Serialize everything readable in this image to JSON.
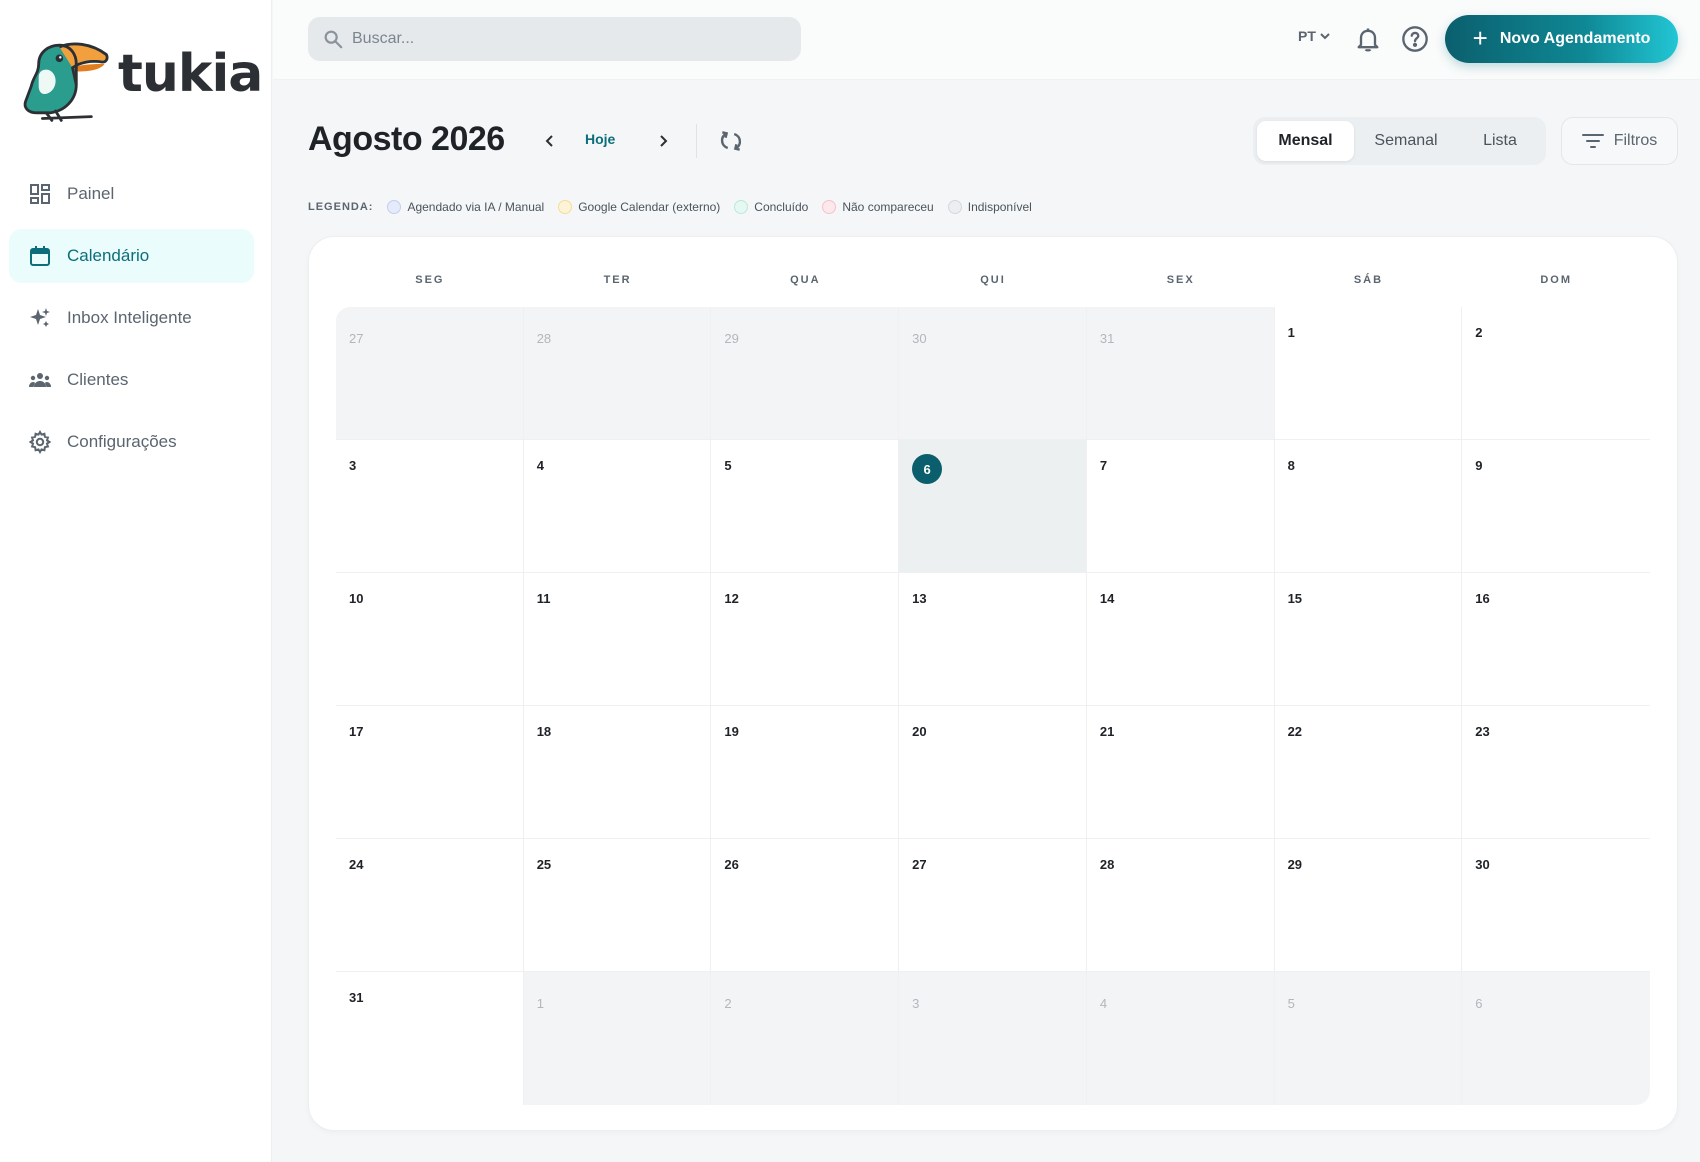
{
  "brand": {
    "name": "tukia"
  },
  "sidebar": {
    "items": [
      {
        "label": "Painel",
        "icon": "dashboard-icon",
        "active": false
      },
      {
        "label": "Calendário",
        "icon": "calendar-icon",
        "active": true
      },
      {
        "label": "Inbox Inteligente",
        "icon": "sparkles-icon",
        "active": false
      },
      {
        "label": "Clientes",
        "icon": "users-icon",
        "active": false
      },
      {
        "label": "Configurações",
        "icon": "gear-icon",
        "active": false
      }
    ]
  },
  "topbar": {
    "search_placeholder": "Buscar...",
    "language": "PT",
    "new_button_label": "Novo Agendamento"
  },
  "calendar": {
    "month_title": "Agosto 2026",
    "today_label": "Hoje",
    "views": [
      "Mensal",
      "Semanal",
      "Lista"
    ],
    "active_view": "Mensal",
    "filters_label": "Filtros",
    "weekdays": [
      "SEG",
      "TER",
      "QUA",
      "QUI",
      "SEX",
      "SÁB",
      "DOM"
    ],
    "today": "6"
  },
  "legend": {
    "title": "LEGENDA:",
    "items": [
      {
        "label": "Agendado via IA / Manual",
        "fill": "#e6ebfb",
        "border": "#c4cdf2"
      },
      {
        "label": "Google Calendar (externo)",
        "fill": "#fdf3d6",
        "border": "#f3dd98"
      },
      {
        "label": "Concluído",
        "fill": "#e5f8f1",
        "border": "#b8eadb"
      },
      {
        "label": "Não compareceu",
        "fill": "#fde8ec",
        "border": "#f6c2cc"
      },
      {
        "label": "Indisponível",
        "fill": "#eceef1",
        "border": "#d3d8dd"
      }
    ]
  },
  "days": [
    {
      "d": "27",
      "out": true
    },
    {
      "d": "28",
      "out": true
    },
    {
      "d": "29",
      "out": true
    },
    {
      "d": "30",
      "out": true
    },
    {
      "d": "31",
      "out": true
    },
    {
      "d": "1",
      "out": false
    },
    {
      "d": "2",
      "out": false
    },
    {
      "d": "3",
      "out": false
    },
    {
      "d": "4",
      "out": false
    },
    {
      "d": "5",
      "out": false
    },
    {
      "d": "6",
      "out": false
    },
    {
      "d": "7",
      "out": false
    },
    {
      "d": "8",
      "out": false
    },
    {
      "d": "9",
      "out": false
    },
    {
      "d": "10",
      "out": false
    },
    {
      "d": "11",
      "out": false
    },
    {
      "d": "12",
      "out": false
    },
    {
      "d": "13",
      "out": false
    },
    {
      "d": "14",
      "out": false
    },
    {
      "d": "15",
      "out": false
    },
    {
      "d": "16",
      "out": false
    },
    {
      "d": "17",
      "out": false
    },
    {
      "d": "18",
      "out": false
    },
    {
      "d": "19",
      "out": false
    },
    {
      "d": "20",
      "out": false
    },
    {
      "d": "21",
      "out": false
    },
    {
      "d": "22",
      "out": false
    },
    {
      "d": "23",
      "out": false
    },
    {
      "d": "24",
      "out": false
    },
    {
      "d": "25",
      "out": false
    },
    {
      "d": "26",
      "out": false
    },
    {
      "d": "27",
      "out": false
    },
    {
      "d": "28",
      "out": false
    },
    {
      "d": "29",
      "out": false
    },
    {
      "d": "30",
      "out": false
    },
    {
      "d": "31",
      "out": false
    },
    {
      "d": "1",
      "out": true
    },
    {
      "d": "2",
      "out": true
    },
    {
      "d": "3",
      "out": true
    },
    {
      "d": "4",
      "out": true
    },
    {
      "d": "5",
      "out": true
    },
    {
      "d": "6",
      "out": true
    }
  ],
  "colors": {
    "accent": "#0b6e7a",
    "today_badge": "#0b5f6d"
  }
}
